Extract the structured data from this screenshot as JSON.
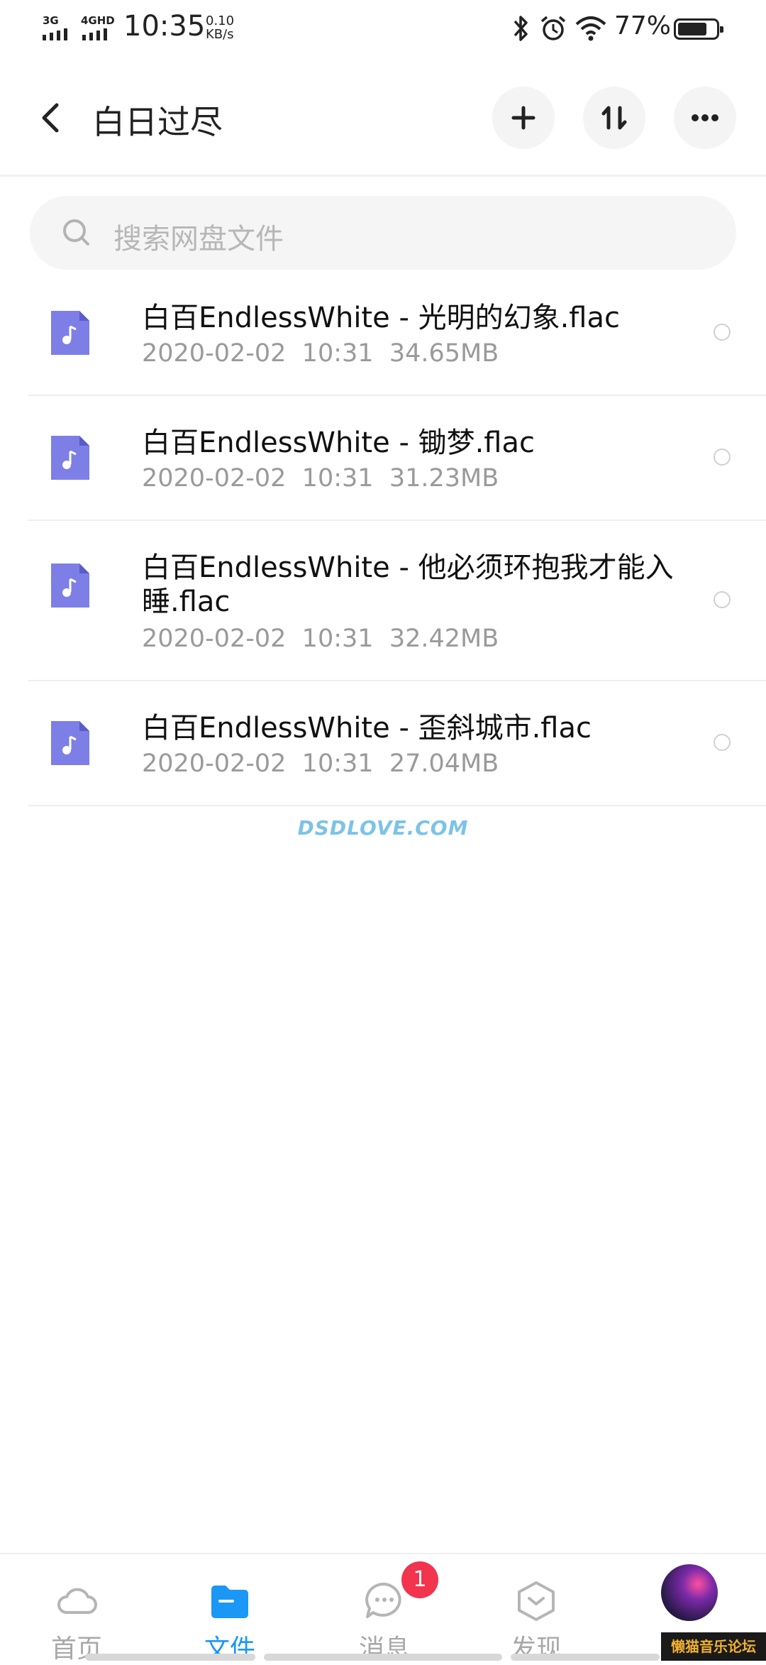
{
  "status_bar": {
    "network_1": "3G",
    "network_2": "4GHD",
    "time": "10:35",
    "speed_value": "0.10",
    "speed_unit": "KB/s",
    "battery": "77%",
    "battery_level": 0.77
  },
  "header": {
    "title": "白日过尽"
  },
  "search": {
    "placeholder": "搜索网盘文件"
  },
  "files": [
    {
      "name": "白百EndlessWhite - 光明的幻象.flac",
      "date": "2020-02-02",
      "time": "10:31",
      "size": "34.65MB"
    },
    {
      "name": "白百EndlessWhite - 锄梦.flac",
      "date": "2020-02-02",
      "time": "10:31",
      "size": "31.23MB"
    },
    {
      "name": "白百EndlessWhite - 他必须环抱我才能入睡.flac",
      "date": "2020-02-02",
      "time": "10:31",
      "size": "32.42MB"
    },
    {
      "name": "白百EndlessWhite - 歪斜城市.flac",
      "date": "2020-02-02",
      "time": "10:31",
      "size": "27.04MB"
    }
  ],
  "watermark": "DSDLOVE.COM",
  "nav": {
    "tabs": [
      {
        "label": "首页",
        "icon": "cloud-icon"
      },
      {
        "label": "文件",
        "icon": "folder-icon",
        "active": true
      },
      {
        "label": "消息",
        "icon": "chat-icon"
      },
      {
        "label": "发现",
        "icon": "discover-icon"
      }
    ],
    "message_badge": "1"
  },
  "forum_logo": "懒猫音乐论坛",
  "colors": {
    "accent": "#1b97f5",
    "badge": "#f2344e",
    "audio_icon": "#7d7fe6"
  }
}
